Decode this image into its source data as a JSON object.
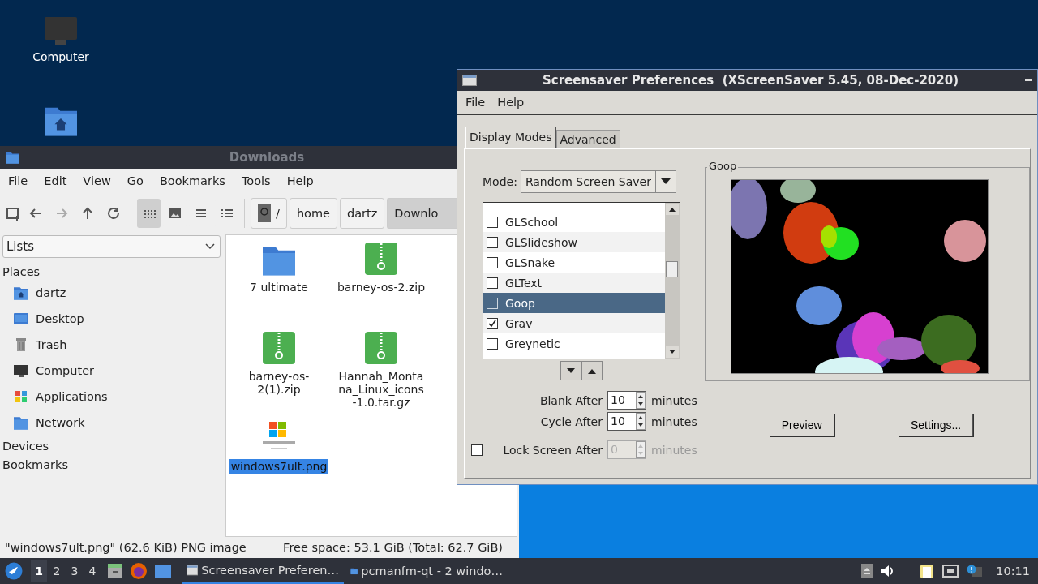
{
  "desktop": {
    "icons": [
      {
        "kind": "computer",
        "label": "Computer"
      },
      {
        "kind": "home-folder"
      }
    ]
  },
  "file_manager": {
    "title": "Downloads",
    "menu": [
      "File",
      "Edit",
      "View",
      "Go",
      "Bookmarks",
      "Tools",
      "Help"
    ],
    "view_buttons": [
      {
        "kind": "icons",
        "selected": true
      },
      {
        "kind": "thumbnails",
        "selected": false
      },
      {
        "kind": "compact",
        "selected": false
      },
      {
        "kind": "details",
        "selected": false
      }
    ],
    "breadcrumb": [
      {
        "label": "/",
        "kind": "root",
        "selected": false
      },
      {
        "label": "home",
        "kind": "dir",
        "selected": false
      },
      {
        "label": "dartz",
        "kind": "dir",
        "selected": false
      },
      {
        "label": "Downlo",
        "kind": "dir",
        "selected": true
      }
    ],
    "sidebar": {
      "view_select": "Lists",
      "sections": [
        {
          "title": "Places",
          "items": [
            {
              "label": "dartz",
              "kind": "home"
            },
            {
              "label": "Desktop",
              "kind": "desktop"
            },
            {
              "label": "Trash",
              "kind": "trash"
            },
            {
              "label": "Computer",
              "kind": "computer"
            },
            {
              "label": "Applications",
              "kind": "apps"
            },
            {
              "label": "Network",
              "kind": "network"
            }
          ]
        },
        {
          "title": "Devices"
        },
        {
          "title": "Bookmarks"
        }
      ]
    },
    "files": [
      {
        "name": "7 ultimate",
        "kind": "folder",
        "selected": false
      },
      {
        "name": "barney-os-2.zip",
        "kind": "archive",
        "selected": false
      },
      {
        "name": "barney-os-2(1).zip",
        "kind": "archive",
        "selected": false
      },
      {
        "name": "Hannah_Montana_Linux_icons-1.0.tar.gz",
        "kind": "archive",
        "selected": false
      },
      {
        "name": "windows7ult.png",
        "kind": "image",
        "selected": true
      }
    ],
    "status_bar": {
      "selection": "\"windows7ult.png\" (62.6 KiB) PNG image",
      "free_space": "Free space: 53.1 GiB (Total: 62.7 GiB)"
    }
  },
  "screensaver": {
    "title": "Screensaver Preferences  (XScreenSaver 5.45, 08-Dec-2020)",
    "menu": [
      "File",
      "Help"
    ],
    "tabs": [
      {
        "label": "Display Modes",
        "selected": true
      },
      {
        "label": "Advanced",
        "selected": false
      }
    ],
    "mode": {
      "label": "Mode:",
      "value": "Random Screen Saver"
    },
    "modes": [
      {
        "name": "GLSchool",
        "checked": false,
        "selected": false
      },
      {
        "name": "GLSlideshow",
        "checked": false,
        "selected": false
      },
      {
        "name": "GLSnake",
        "checked": false,
        "selected": false
      },
      {
        "name": "GLText",
        "checked": false,
        "selected": false
      },
      {
        "name": "Goop",
        "checked": false,
        "selected": true
      },
      {
        "name": "Grav",
        "checked": true,
        "selected": false
      },
      {
        "name": "Greynetic",
        "checked": false,
        "selected": false
      }
    ],
    "timers": [
      {
        "kind": "plain",
        "label": "Blank After",
        "value": "10",
        "unit": "minutes",
        "disabled": false
      },
      {
        "kind": "plain",
        "label": "Cycle After",
        "value": "10",
        "unit": "minutes",
        "disabled": false
      },
      {
        "kind": "toggle",
        "label": "Lock Screen After",
        "value": "0",
        "unit": "minutes",
        "checked": false,
        "disabled": true
      }
    ],
    "preview_title": "Goop",
    "buttons": [
      "Preview",
      "Settings..."
    ]
  },
  "taskbar": {
    "workspaces": [
      {
        "label": "1",
        "selected": true
      },
      {
        "label": "2",
        "selected": false
      },
      {
        "label": "3",
        "selected": false
      },
      {
        "label": "4",
        "selected": false
      }
    ],
    "tasks": [
      {
        "label": "Screensaver Preferen…",
        "kind": "dialog",
        "selected": true
      },
      {
        "label": "pcmanfm-qt - 2 windo…",
        "kind": "folder",
        "selected": false
      }
    ],
    "clock": "10:11"
  }
}
